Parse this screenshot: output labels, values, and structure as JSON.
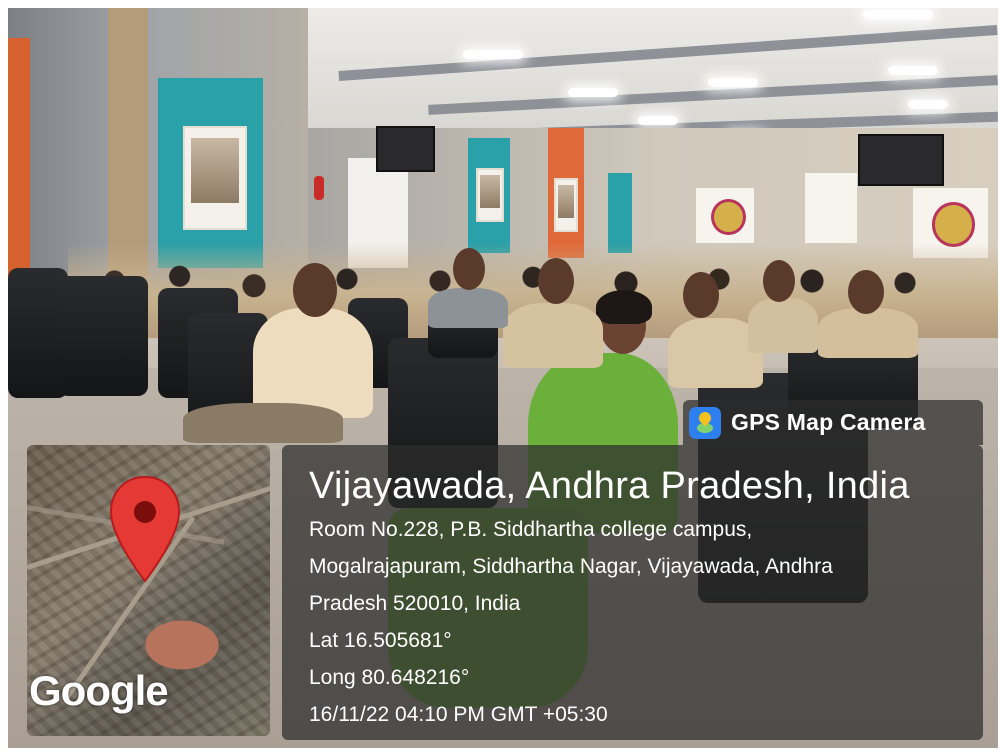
{
  "overlay": {
    "app_icon": "gps-map-camera-icon",
    "app_name": "GPS Map Camera",
    "city_line": "Vijayawada, Andhra Pradesh, India",
    "address_line_1": "Room No.228, P.B. Siddhartha college campus,",
    "address_line_2": "Mogalrajapuram, Siddhartha Nagar, Vijayawada, Andhra",
    "address_line_3": "Pradesh 520010, India",
    "latitude": "Lat 16.505681°",
    "longitude": "Long 80.648216°",
    "timestamp": "16/11/22 04:10 PM GMT +05:30"
  },
  "map": {
    "logo_text": "Google",
    "pin_icon": "map-pin-icon",
    "pin_color": "#e53935"
  },
  "colors": {
    "panel_background": "rgba(45,45,45,0.72)",
    "text": "#ffffff"
  }
}
